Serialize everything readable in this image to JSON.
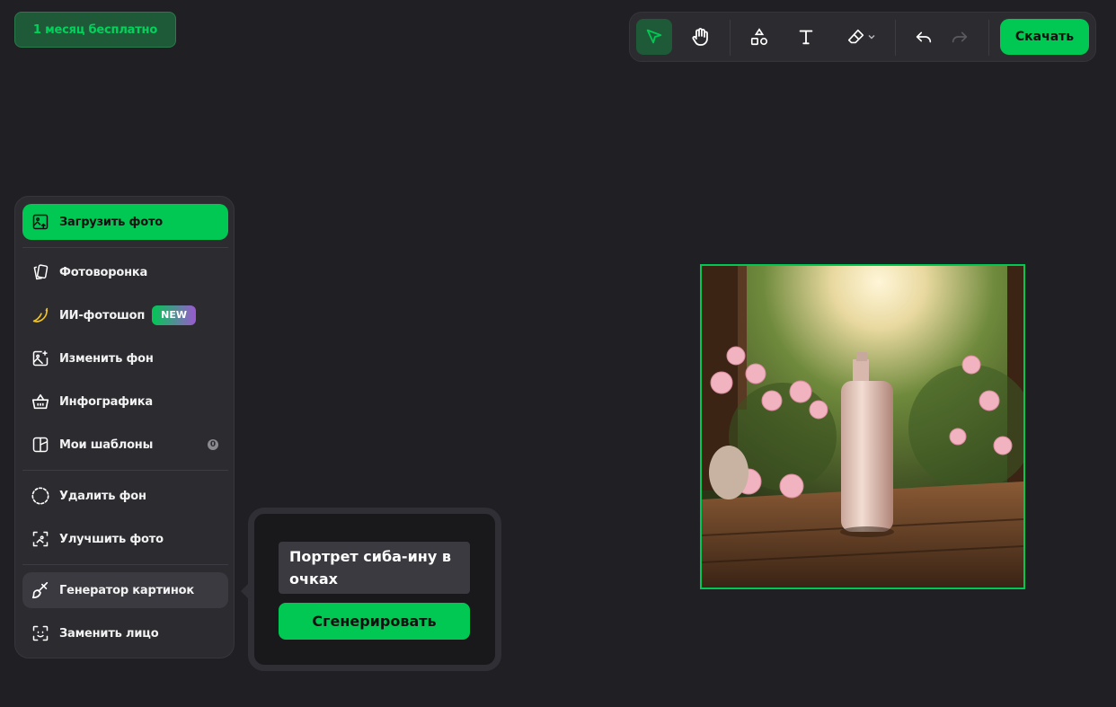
{
  "promo": {
    "label": "1 месяц бесплатно"
  },
  "toolbar": {
    "tools": [
      "select-tool",
      "hand-tool",
      "shapes-tool",
      "text-tool",
      "eraser-tool",
      "undo",
      "redo"
    ],
    "download_label": "Скачать",
    "accent": "#00c853"
  },
  "sidebar": {
    "upload_label": "Загрузить фото",
    "items": [
      {
        "label": "Фотоворонка",
        "icon": "cards-icon"
      },
      {
        "label": "ИИ-фотошоп",
        "icon": "banana-icon",
        "badge": "NEW"
      },
      {
        "label": "Изменить фон",
        "icon": "image-plus-icon"
      },
      {
        "label": "Инфографика",
        "icon": "basket-icon"
      },
      {
        "label": "Мои шаблоны",
        "icon": "templates-icon",
        "count": "0"
      },
      {
        "label": "Удалить фон",
        "icon": "remove-bg-icon"
      },
      {
        "label": "Улучшить фото",
        "icon": "enhance-icon"
      },
      {
        "label": "Генератор картинок",
        "icon": "brush-icon"
      },
      {
        "label": "Заменить лицо",
        "icon": "face-swap-icon"
      }
    ]
  },
  "generator": {
    "prompt": "Портрет сиба-ину в очках",
    "button_label": "Сгенерировать"
  }
}
